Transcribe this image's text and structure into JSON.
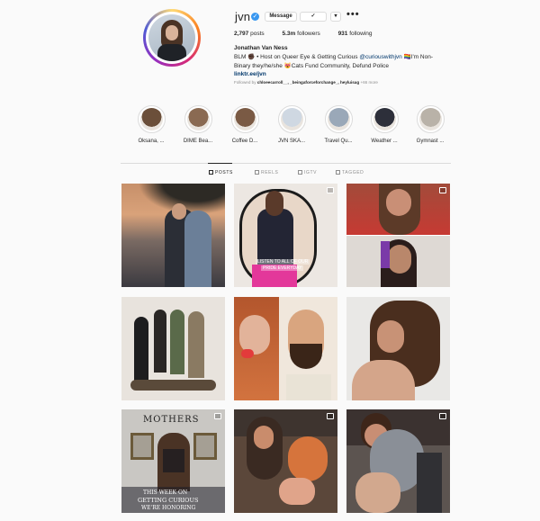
{
  "profile": {
    "username": "jvn",
    "message_label": "Message",
    "follow_glyph": "✓",
    "dropdown_glyph": "▾",
    "options_glyph": "•••",
    "posts_count": "2,797",
    "posts_label": "posts",
    "followers_count": "5.3m",
    "followers_label": "followers",
    "following_count": "931",
    "following_label": "following",
    "full_name": "Jonathan Van Ness",
    "bio_line1_start": "BLM ✊🏿 • Host on Queer Eye & Getting Curious ",
    "bio_mention": "@curiouswithjvn",
    "bio_line1_end": " 🏳️‍🌈I'm Non-",
    "bio_line2": "Binary they/he/she 😻Cats Fund Community, Defund Police",
    "bio_link": "linktr.ee/jvn",
    "followed_by_prefix": "Followed by",
    "followed_by_names": "chloeecarroll__, _beingaforceforchange_, heyluisag",
    "followed_by_more": "+66 more"
  },
  "highlights": [
    {
      "label": "Oksana, ...",
      "color": "#6b4f3a"
    },
    {
      "label": "DIME Bea...",
      "color": "#8a6a52"
    },
    {
      "label": "Coffee D...",
      "color": "#7a5a44"
    },
    {
      "label": "JVN SKA...",
      "color": "#cfd8e2"
    },
    {
      "label": "Travel Qu...",
      "color": "#9aa8b8"
    },
    {
      "label": "Weather ...",
      "color": "#2d2f3a"
    },
    {
      "label": "Gymnast ...",
      "color": "#b9b2a8"
    }
  ],
  "tabs": [
    {
      "label": "POSTS"
    },
    {
      "label": "REELS"
    },
    {
      "label": "IGTV"
    },
    {
      "label": "TAGGED"
    }
  ],
  "posts": {
    "p2_caption": "LISTEN TO ALL OF OUR",
    "p2_caption2": "PRIDE EVERYDAY",
    "p7_title": "MOTHERS",
    "p7_caption1": "THIS WEEK ON",
    "p7_caption2": "GETTING CURIOUS",
    "p7_caption3": "WE'RE HONORING"
  },
  "colors": {
    "accent": "#3897f0",
    "link": "#00376b",
    "border": "#dbdbdb",
    "muted": "#8e8e8e"
  },
  "icons": [
    "verified-icon",
    "person-check-icon",
    "chevron-down-icon",
    "more-options-icon",
    "grid-icon",
    "reels-icon",
    "igtv-icon",
    "tagged-icon",
    "carousel-icon",
    "video-icon"
  ]
}
